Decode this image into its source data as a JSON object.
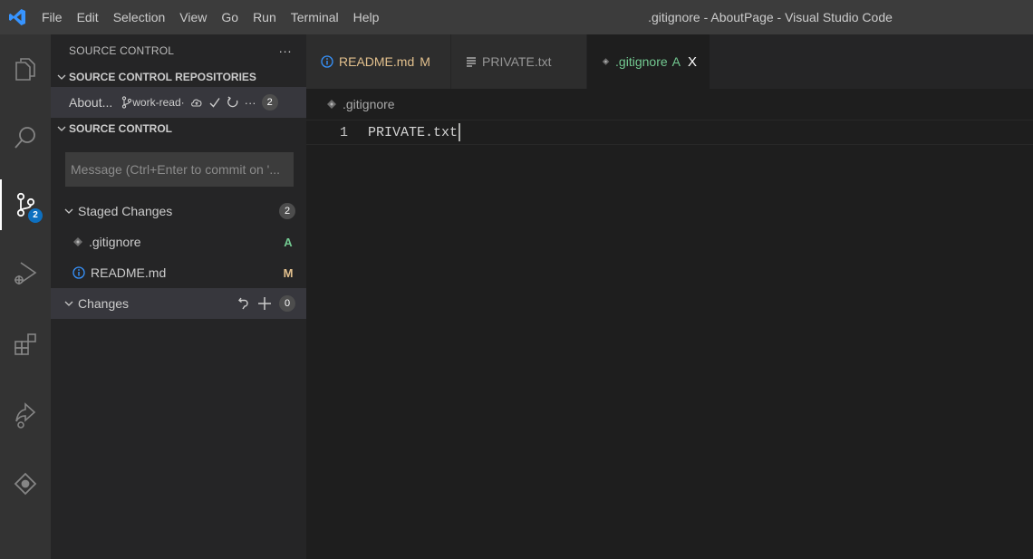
{
  "menu": {
    "items": [
      "File",
      "Edit",
      "Selection",
      "View",
      "Go",
      "Run",
      "Terminal",
      "Help"
    ]
  },
  "window": {
    "title": ".gitignore - AboutPage - Visual Studio Code"
  },
  "activity": {
    "scm_badge": "2"
  },
  "sidebar": {
    "header": "SOURCE CONTROL",
    "more": "···",
    "repos_section": "SOURCE CONTROL REPOSITORIES",
    "repo": {
      "name": "About...",
      "branch": "work-read·",
      "count": "2"
    },
    "scm_section": "SOURCE CONTROL",
    "message_placeholder": "Message (Ctrl+Enter to commit on '...",
    "staged": {
      "label": "Staged Changes",
      "count": "2",
      "files": [
        {
          "name": ".gitignore",
          "status": "A",
          "status_color": "#73c991"
        },
        {
          "name": "README.md",
          "status": "M",
          "status_color": "#e2c08d"
        }
      ]
    },
    "changes": {
      "label": "Changes",
      "count": "0"
    }
  },
  "tabs": [
    {
      "label": "README.md",
      "status": "M",
      "color": "#e2c08d",
      "icon": "info-icon"
    },
    {
      "label": "PRIVATE.txt",
      "status": "",
      "color": "#969696",
      "icon": "text-file-icon"
    },
    {
      "label": ".gitignore",
      "status": "A",
      "color": "#73c991",
      "icon": "git-icon",
      "close": "X"
    }
  ],
  "editor": {
    "breadcrumb": ".gitignore",
    "lines": [
      {
        "number": "1",
        "text": "PRIVATE.txt"
      }
    ]
  },
  "colors": {
    "accent": "#0e70c0",
    "added": "#73c991",
    "modified": "#e2c08d",
    "info": "#3794ff"
  }
}
